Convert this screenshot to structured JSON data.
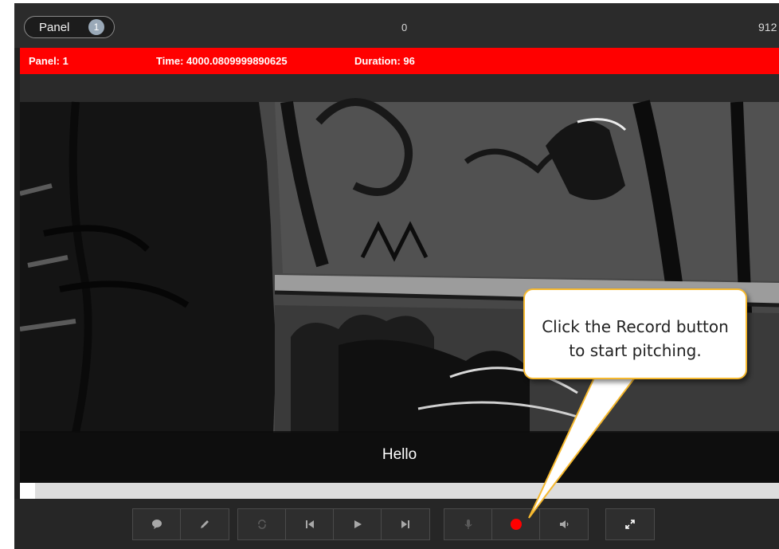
{
  "topbar": {
    "panel_label": "Panel",
    "panel_count": "1",
    "frame_counter": "0",
    "frame_right": "912"
  },
  "infobar": {
    "panel": "Panel: 1",
    "time": "Time: 4000.0809999890625",
    "duration": "Duration: 96",
    "background": "#ff0000"
  },
  "viewer": {
    "subtitle": "Hello"
  },
  "progress": {
    "fraction": 0.02
  },
  "controls": {
    "groups": [
      [
        "comment-icon",
        "pencil-icon"
      ],
      [
        "loop-icon",
        "skip-back-icon",
        "play-icon",
        "skip-forward-icon"
      ],
      [
        "microphone-icon",
        "record-icon",
        "volume-icon"
      ],
      [
        "fullscreen-icon"
      ]
    ],
    "record_color": "#ff0000"
  },
  "callout": {
    "line1": "Click the Record button",
    "line2": "to start pitching.",
    "border_color": "#f5b82e"
  }
}
